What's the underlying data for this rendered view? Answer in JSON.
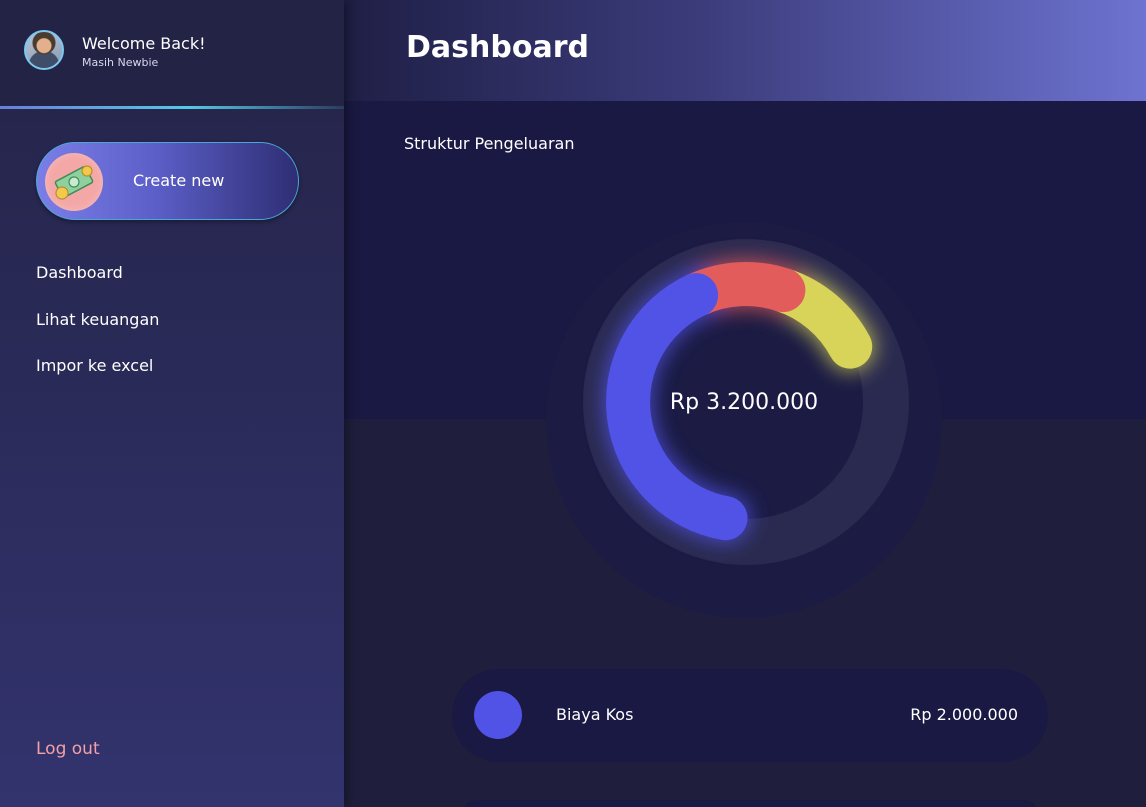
{
  "profile": {
    "welcome": "Welcome Back!",
    "username": "Masih Newbie"
  },
  "sidebar": {
    "create_label": "Create new",
    "items": [
      {
        "label": "Dashboard"
      },
      {
        "label": "Lihat keuangan"
      },
      {
        "label": "Impor ke excel"
      }
    ],
    "logout_label": "Log out"
  },
  "header": {
    "title": "Dashboard"
  },
  "chart": {
    "section_title": "Struktur Pengeluaran",
    "total": "Rp 3.200.000"
  },
  "chart_data": {
    "type": "pie",
    "center_label": "Rp 3.200.000",
    "segments": [
      {
        "label": "Biaya Kos",
        "value": 2000000,
        "color": "#5152e6"
      },
      {
        "value": 600000,
        "color": "#e25c5c"
      },
      {
        "value": 600000,
        "color": "#d8d45a"
      }
    ]
  },
  "legend": [
    {
      "name": "Biaya Kos",
      "value": "Rp 2.000.000",
      "color": "#5152e6"
    }
  ],
  "colors": {
    "background": "#1f1f3d",
    "panel": "#1a1943",
    "accent": "#5152e6",
    "logout": "#f4a0a6",
    "ring_track": "#2a2a50"
  }
}
